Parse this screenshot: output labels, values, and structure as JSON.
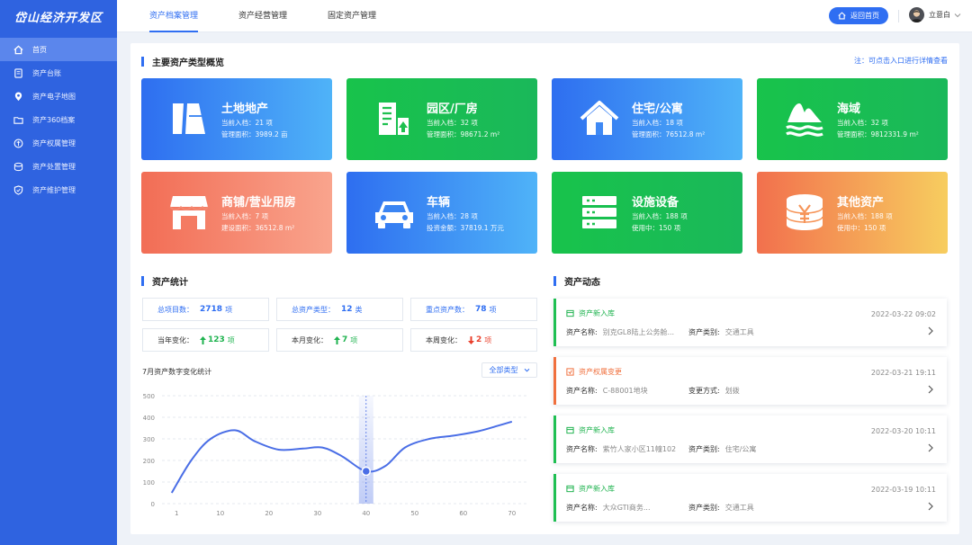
{
  "app_title": "岱山经济开发区",
  "sidebar": {
    "items": [
      {
        "label": "首页",
        "icon": "home-icon",
        "active": true
      },
      {
        "label": "资产台账",
        "icon": "ledger-icon"
      },
      {
        "label": "资产电子地图",
        "icon": "location-pin-icon"
      },
      {
        "label": "资产360档案",
        "icon": "folder-icon"
      },
      {
        "label": "资产权属管理",
        "icon": "certificate-icon"
      },
      {
        "label": "资产处置管理",
        "icon": "disposal-icon"
      },
      {
        "label": "资产维护管理",
        "icon": "shield-icon"
      }
    ]
  },
  "header": {
    "nav": [
      "资产档案管理",
      "资产经营管理",
      "固定资产管理"
    ],
    "active_nav": 0,
    "home_button": "返回首页",
    "user_name": "立意白"
  },
  "overview": {
    "title": "主要资产类型概览",
    "note": "注：可点击入口进行详情查看",
    "cards": [
      {
        "title": "土地地产",
        "line1": "当前入档：21 项",
        "line2": "管理面积：3989.2 亩",
        "icon": "land-icon"
      },
      {
        "title": "园区/厂房",
        "line1": "当前入档：32 项",
        "line2": "管理面积：98671.2 m²",
        "icon": "factory-building-icon"
      },
      {
        "title": "住宅/公寓",
        "line1": "当前入档：18 项",
        "line2": "管理面积：76512.8 m²",
        "icon": "house-icon"
      },
      {
        "title": "海域",
        "line1": "当前入档：32 项",
        "line2": "管理面积：9812331.9 m²",
        "icon": "sea-area-icon"
      },
      {
        "title": "商铺/营业用房",
        "line1": "当前入档：7 项",
        "line2": "建设面积：36512.8 m²",
        "icon": "shop-icon"
      },
      {
        "title": "车辆",
        "line1": "当前入档：28 项",
        "line2": "投资金额：37819.1 万元",
        "icon": "car-icon"
      },
      {
        "title": "设施设备",
        "line1": "当前入档：188 项",
        "line2": "使用中：150 项",
        "icon": "server-rack-icon"
      },
      {
        "title": "其他资产",
        "line1": "当前入档：188 项",
        "line2": "使用中：150 项",
        "icon": "yuan-coins-icon"
      }
    ]
  },
  "stats": {
    "title": "资产统计",
    "boxes": [
      {
        "label": "总项目数：",
        "value": "2718",
        "unit": "项"
      },
      {
        "label": "总资产类型：",
        "value": "12",
        "unit": "类"
      },
      {
        "label": "重点资产数：",
        "value": "78",
        "unit": "项"
      },
      {
        "label": "当年变化：",
        "value": "123",
        "unit": "项",
        "trend": "up"
      },
      {
        "label": "本月变化：",
        "value": "7",
        "unit": "项",
        "trend": "up"
      },
      {
        "label": "本周变化：",
        "value": "2",
        "unit": "项",
        "trend": "down"
      }
    ],
    "chart_title": "7月资产数字变化统计",
    "filter": "全部类型"
  },
  "chart_data": {
    "type": "line",
    "title": "7月资产数字变化统计",
    "x_ticks": [
      1,
      10,
      20,
      30,
      40,
      50,
      60,
      70
    ],
    "y_ticks": [
      0,
      100,
      200,
      300,
      400,
      500
    ],
    "ylim": [
      0,
      500
    ],
    "xlim": [
      -2,
      73
    ],
    "grid": true,
    "highlight_x": 40,
    "color": "#4a6ee6",
    "series": [
      {
        "x": [
          0,
          4,
          8,
          13,
          17,
          22,
          27,
          31,
          35,
          40,
          44,
          48,
          53,
          58,
          63,
          67,
          70
        ],
        "y": [
          50,
          200,
          300,
          340,
          290,
          250,
          255,
          260,
          220,
          150,
          175,
          260,
          300,
          315,
          335,
          360,
          380
        ]
      }
    ]
  },
  "activity": {
    "title": "资产动态",
    "items": [
      {
        "type": "资产新入库",
        "time": "2022-03-22 09:02",
        "f1_label": "资产名称:",
        "f1_value": "别克GL8陆上公务舱...",
        "f2_label": "资产类别:",
        "f2_value": "交通工具",
        "color": "green"
      },
      {
        "type": "资产权属变更",
        "time": "2022-03-21 19:11",
        "f1_label": "资产名称:",
        "f1_value": "C-88001地块",
        "f2_label": "变更方式:",
        "f2_value": "划拨",
        "color": "orange"
      },
      {
        "type": "资产新入库",
        "time": "2022-03-20 10:11",
        "f1_label": "资产名称:",
        "f1_value": "紫竹人家小区11幢102",
        "f2_label": "资产类别:",
        "f2_value": "住宅/公寓",
        "color": "green"
      },
      {
        "type": "资产新入库",
        "time": "2022-03-19 10:11",
        "f1_label": "资产名称:",
        "f1_value": "大众GTI商务...",
        "f2_label": "资产类别:",
        "f2_value": "交通工具",
        "color": "green"
      }
    ]
  }
}
